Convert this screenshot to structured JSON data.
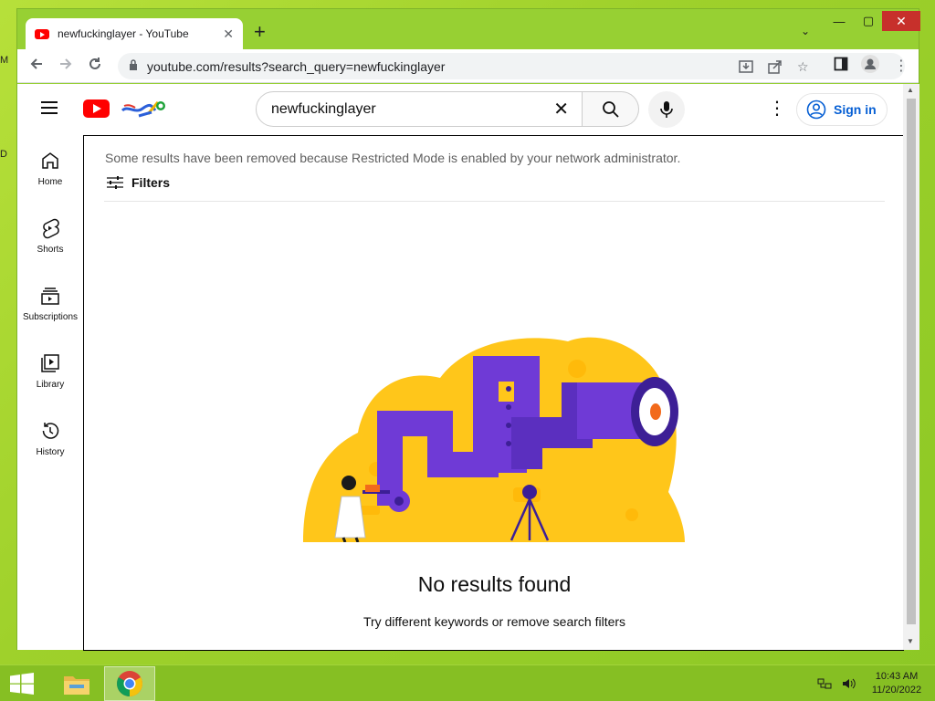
{
  "browser": {
    "tab_title": "newfuckinglayer - YouTube",
    "url": "youtube.com/results?search_query=newfuckinglayer"
  },
  "youtube": {
    "search_query": "newfuckinglayer",
    "sign_in_label": "Sign in",
    "guide": [
      {
        "label": "Home",
        "icon": "home-icon"
      },
      {
        "label": "Shorts",
        "icon": "shorts-icon"
      },
      {
        "label": "Subscriptions",
        "icon": "subscriptions-icon"
      },
      {
        "label": "Library",
        "icon": "library-icon"
      },
      {
        "label": "History",
        "icon": "history-icon"
      }
    ],
    "restricted_notice": "Some results have been removed because Restricted Mode is enabled by your network administrator.",
    "filters_label": "Filters",
    "no_results_title": "No results found",
    "no_results_hint": "Try different keywords or remove search filters"
  },
  "taskbar": {
    "time": "10:43 AM",
    "date": "11/20/2022"
  },
  "colors": {
    "accent_red": "#ff0000",
    "link_blue": "#065fd4",
    "desktop_green": "#8cc825",
    "illustration_yellow": "#ffc61a",
    "illustration_purple": "#6f3ad6"
  }
}
